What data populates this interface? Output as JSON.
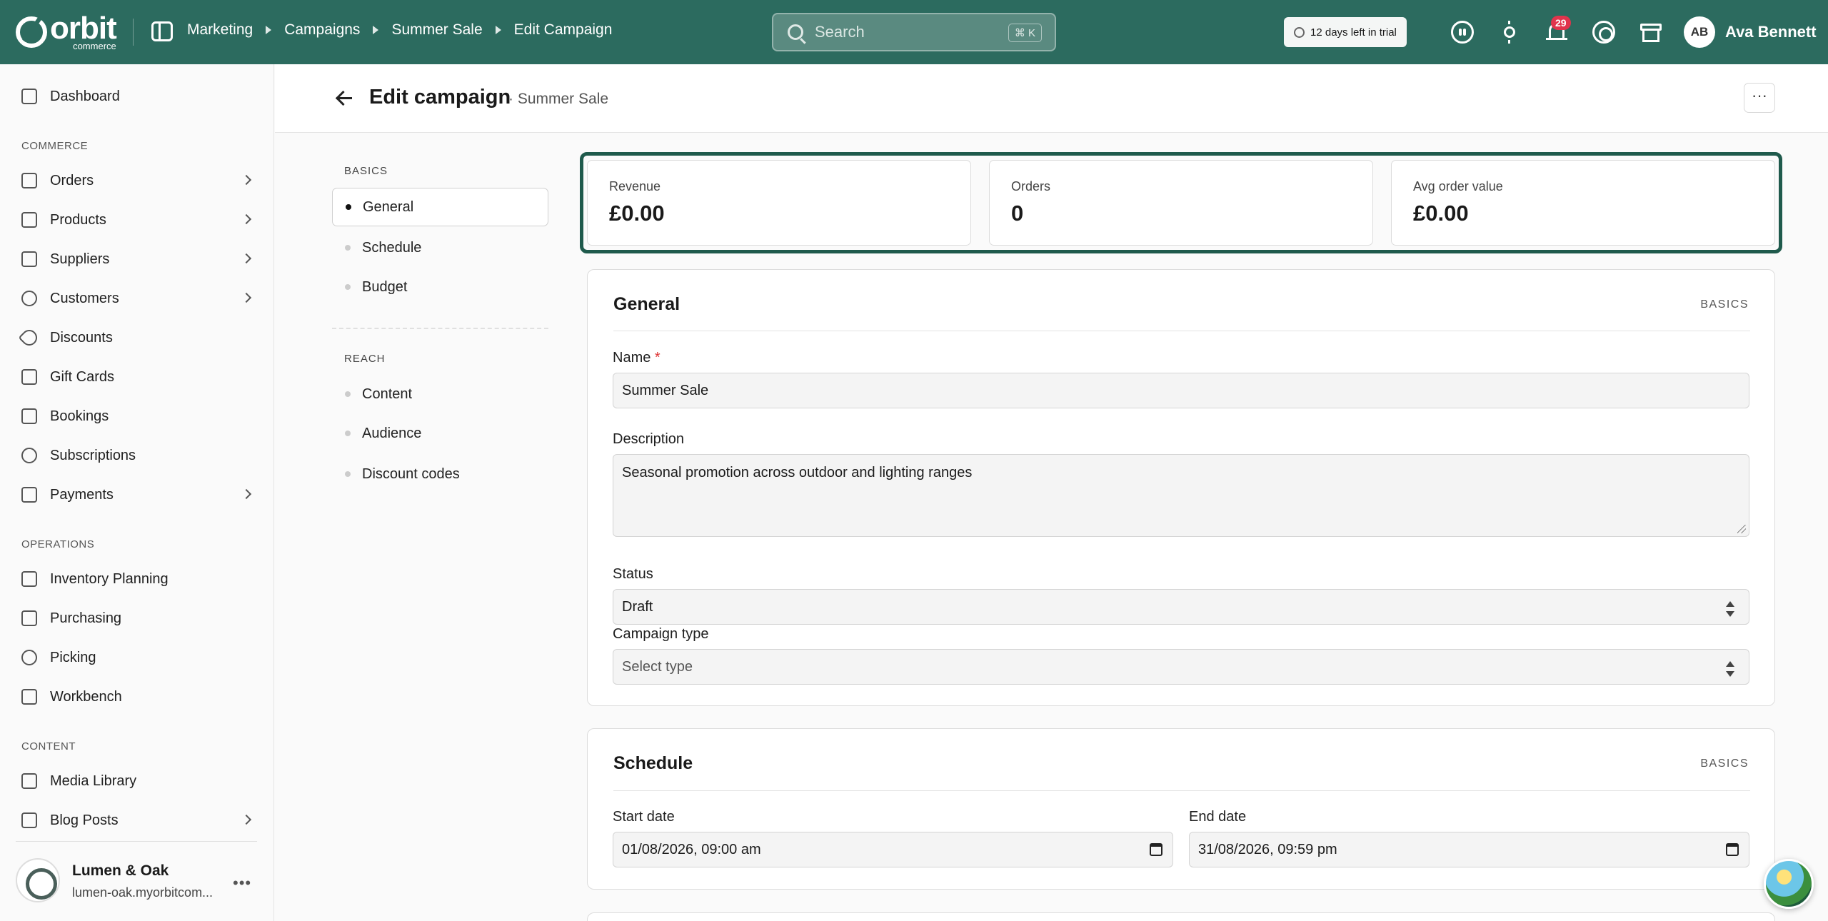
{
  "topbar": {
    "logo_word": "orbit",
    "logo_sub": "commerce",
    "breadcrumbs": [
      "Marketing",
      "Campaigns",
      "Summer Sale",
      "Edit Campaign"
    ],
    "search_placeholder": "Search",
    "search_shortcut": "⌘ K",
    "trial_text": "12 days left in trial",
    "notifications_count": "29",
    "user_initials": "AB",
    "user_name": "Ava Bennett",
    "accent_color": "#2c6b5f"
  },
  "sidebar": {
    "dashboard": "Dashboard",
    "sections": {
      "commerce": "COMMERCE",
      "operations": "OPERATIONS",
      "content": "CONTENT"
    },
    "commerce_items": [
      "Orders",
      "Products",
      "Suppliers",
      "Customers",
      "Discounts",
      "Gift Cards",
      "Bookings",
      "Subscriptions",
      "Payments"
    ],
    "operations_items": [
      "Inventory Planning",
      "Purchasing",
      "Picking",
      "Workbench"
    ],
    "content_items": [
      "Media Library",
      "Blog Posts"
    ],
    "store": {
      "name": "Lumen & Oak",
      "url": "lumen-oak.myorbitcom..."
    }
  },
  "page": {
    "title": "Edit campaign",
    "subtitle": "· Summer Sale",
    "more": "···"
  },
  "subnav": {
    "basics_label": "BASICS",
    "basics_items": [
      "General",
      "Schedule",
      "Budget"
    ],
    "reach_label": "REACH",
    "reach_items": [
      "Content",
      "Audience",
      "Discount codes"
    ],
    "active": "General"
  },
  "stats": [
    {
      "label": "Revenue",
      "value": "£0.00"
    },
    {
      "label": "Orders",
      "value": "0"
    },
    {
      "label": "Avg order value",
      "value": "£0.00"
    }
  ],
  "general": {
    "title": "General",
    "tag": "BASICS",
    "name_label": "Name",
    "name_required": "*",
    "name_value": "Summer Sale",
    "description_label": "Description",
    "description_value": "Seasonal promotion across outdoor and lighting ranges",
    "status_label": "Status",
    "status_value": "Draft",
    "type_label": "Campaign type",
    "type_placeholder": "Select type"
  },
  "schedule": {
    "title": "Schedule",
    "tag": "BASICS",
    "start_label": "Start date",
    "start_value": "01/08/2026, 09:00 am",
    "end_label": "End date",
    "end_value": "31/08/2026, 09:59 pm"
  }
}
